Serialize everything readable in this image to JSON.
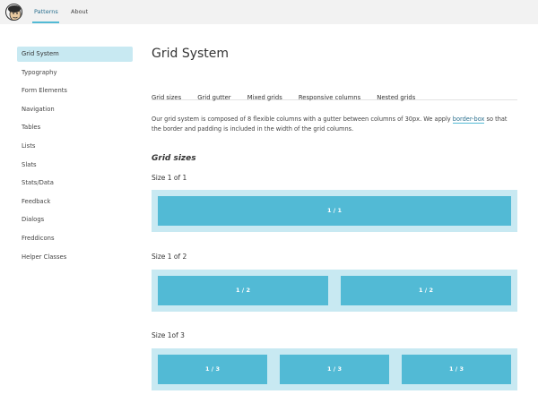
{
  "header": {
    "logo_icon": "freddie-logo-icon",
    "nav": [
      {
        "label": "Patterns",
        "active": true
      },
      {
        "label": "About",
        "active": false
      }
    ]
  },
  "sidebar": {
    "items": [
      {
        "label": "Grid System",
        "active": true
      },
      {
        "label": "Typography"
      },
      {
        "label": "Form Elements"
      },
      {
        "label": "Navigation"
      },
      {
        "label": "Tables"
      },
      {
        "label": "Lists"
      },
      {
        "label": "Slats"
      },
      {
        "label": "Stats/Data"
      },
      {
        "label": "Feedback"
      },
      {
        "label": "Dialogs"
      },
      {
        "label": "Freddicons"
      },
      {
        "label": "Helper Classes"
      }
    ]
  },
  "main": {
    "title": "Grid System",
    "tabs": [
      "Grid sizes",
      "Grid gutter",
      "Mixed grids",
      "Responsive columns",
      "Nested grids"
    ],
    "intro": {
      "before": "Our grid system is composed of 8 flexible columns with a gutter between columns of 30px. We apply ",
      "link": "border-box",
      "after": " so that the border and padding is included in the width of the grid columns."
    },
    "section_heading": "Grid sizes",
    "examples": [
      {
        "label": "Size 1 of 1",
        "columns": [
          "1 / 1"
        ]
      },
      {
        "label": "Size 1 of 2",
        "columns": [
          "1 / 2",
          "1 / 2"
        ]
      },
      {
        "label": "Size 1of 3",
        "columns": [
          "1 / 3",
          "1 / 3",
          "1 / 3"
        ]
      }
    ]
  },
  "colors": {
    "accent": "#52bad5",
    "accent_light": "#c8e9f2",
    "link": "#2a6f8e",
    "topbar_bg": "#f2f2f2"
  }
}
